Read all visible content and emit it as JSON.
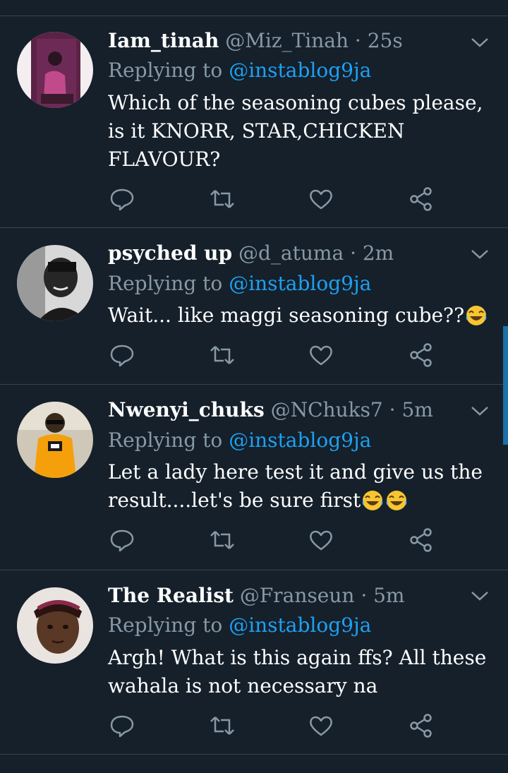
{
  "colors": {
    "background": "#15202b",
    "secondary_text": "#8899a6",
    "mention": "#1da1f2",
    "divider": "#38444d"
  },
  "tweets": [
    {
      "name": "Iam_tinah",
      "handle": "@Miz_Tinah",
      "time": "· 25s",
      "replying_prefix": "Replying to",
      "replying_to": "@instablog9ja",
      "text": "Which of the seasoning cubes please, is it KNORR, STAR,CHICKEN FLAVOUR?",
      "emoji_count": 0
    },
    {
      "name": "psyched up",
      "handle": "@d_atuma",
      "time": "· 2m",
      "replying_prefix": "Replying to",
      "replying_to": "@instablog9ja",
      "text": "Wait... like maggi seasoning cube??",
      "emoji_count": 1
    },
    {
      "name": "Nwenyi_chuks",
      "handle": "@NChuks7",
      "time": "· 5m",
      "replying_prefix": "Replying to",
      "replying_to": "@instablog9ja",
      "text": "Let a lady here test it and give us  the result....let's be sure first",
      "emoji_count": 2
    },
    {
      "name": "The Realist",
      "handle": "@Franseun",
      "time": "· 5m",
      "replying_prefix": "Replying to",
      "replying_to": "@instablog9ja",
      "text": "Argh! What is this again ffs? All these wahala is not necessary na",
      "emoji_count": 0
    }
  ],
  "icons": {
    "reply": "reply-icon",
    "retweet": "retweet-icon",
    "like": "heart-icon",
    "share": "share-icon",
    "more": "chevron-down-icon"
  }
}
